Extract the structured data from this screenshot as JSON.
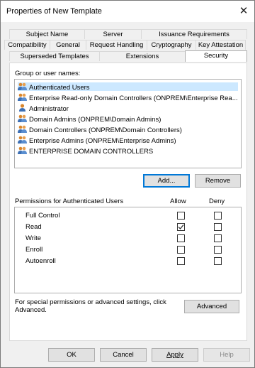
{
  "window": {
    "title": "Properties of New Template",
    "close_glyph": "✕"
  },
  "tabs": {
    "row1": [
      "Subject Name",
      "Server",
      "Issuance Requirements"
    ],
    "row2": [
      "Compatibility",
      "General",
      "Request Handling",
      "Cryptography",
      "Key Attestation"
    ],
    "row3": [
      "Superseded Templates",
      "Extensions",
      "Security"
    ],
    "active": "Security"
  },
  "security": {
    "group_label": "Group or user names:",
    "users": [
      {
        "name": "Authenticated Users",
        "icon": "group-icon",
        "selected": true
      },
      {
        "name": "Enterprise Read-only Domain Controllers (ONPREM\\Enterprise Rea...",
        "icon": "group-icon"
      },
      {
        "name": "Administrator",
        "icon": "user-icon"
      },
      {
        "name": "Domain Admins (ONPREM\\Domain Admins)",
        "icon": "group-icon"
      },
      {
        "name": "Domain Controllers (ONPREM\\Domain Controllers)",
        "icon": "group-icon"
      },
      {
        "name": "Enterprise Admins (ONPREM\\Enterprise Admins)",
        "icon": "group-icon"
      },
      {
        "name": "ENTERPRISE DOMAIN CONTROLLERS",
        "icon": "group-icon"
      }
    ],
    "add_label": "Add...",
    "remove_label": "Remove",
    "permissions_label": "Permissions for Authenticated Users",
    "allow_label": "Allow",
    "deny_label": "Deny",
    "permissions": [
      {
        "name": "Full Control",
        "allow": false,
        "deny": false
      },
      {
        "name": "Read",
        "allow": true,
        "deny": false
      },
      {
        "name": "Write",
        "allow": false,
        "deny": false
      },
      {
        "name": "Enroll",
        "allow": false,
        "deny": false
      },
      {
        "name": "Autoenroll",
        "allow": false,
        "deny": false
      }
    ],
    "advanced_text": "For special permissions or advanced settings, click Advanced.",
    "advanced_label": "Advanced"
  },
  "buttons": {
    "ok": "OK",
    "cancel": "Cancel",
    "apply": "Apply",
    "help": "Help"
  },
  "colors": {
    "selection": "#cce8ff",
    "accent": "#0078d7",
    "icon_blue": "#3c6fb4",
    "icon_orange": "#d8862d"
  }
}
